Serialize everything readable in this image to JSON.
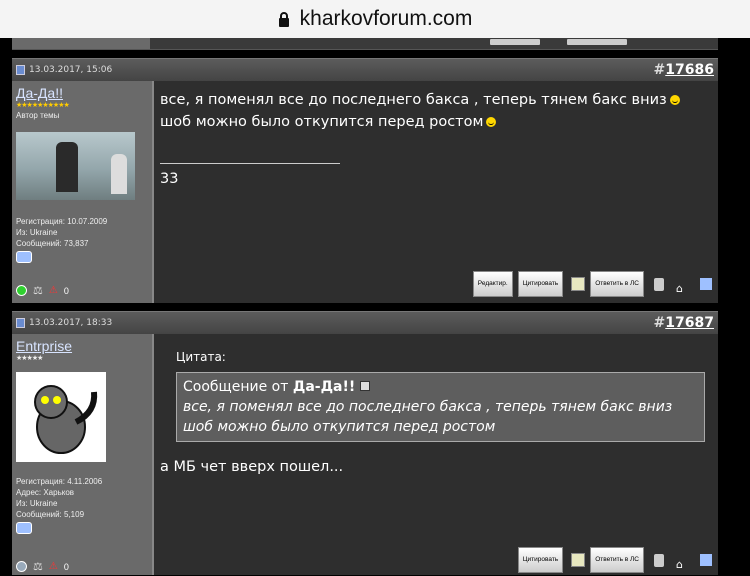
{
  "browser": {
    "url": "kharkovforum.com"
  },
  "posts": [
    {
      "date": "13.03.2017, 15:06",
      "number_prefix": "#",
      "number": "17686",
      "username": "Да-Да!!",
      "stars": "★★★★★★★★★★",
      "role": "Автор темы",
      "info": [
        "Регистрация: 10.07.2009",
        "Из: Ukraine",
        "Сообщений: 73,837"
      ],
      "body_lines": [
        "все, я поменял все до последнего бакса , теперь тянем бакс вниз",
        "шоб можно было откупится перед ростом"
      ],
      "signature": "33",
      "buttons": [
        "Редактир.",
        "Цитировать",
        "Ответить в ЛС"
      ]
    },
    {
      "date": "13.03.2017, 18:33",
      "number_prefix": "#",
      "number": "17687",
      "username": "Entrprise",
      "stars": "★★★★★",
      "info": [
        "Регистрация: 4.11.2006",
        "Адрес: Харьков",
        "Из: Ukraine",
        "Сообщений: 5,109"
      ],
      "quote_label": "Цитата:",
      "quote_from_prefix": "Сообщение от",
      "quote_author": "Да-Да!!",
      "quote_text": "все, я поменял все до последнего бакса , теперь тянем бакс вниз шоб можно было откупится перед ростом",
      "body": "а МБ чет вверх пошел...",
      "buttons": [
        "Цитировать",
        "Ответить в ЛС"
      ]
    }
  ],
  "side_icon_digit": "0",
  "colors": {
    "accent": "#d8e4ff",
    "panel": "#6a6a6a",
    "content_bg": "#2e2e2e"
  }
}
